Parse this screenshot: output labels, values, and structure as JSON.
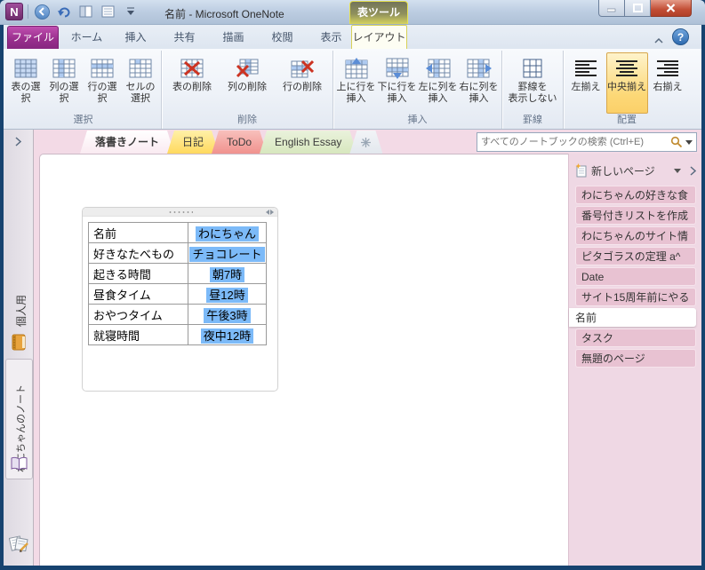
{
  "titlebar": {
    "title": "名前 - Microsoft OneNote",
    "contextual_tool_label": "表ツール"
  },
  "menu_tabs": {
    "file": "ファイル",
    "items": [
      "ホーム",
      "挿入",
      "共有",
      "描画",
      "校閲",
      "表示"
    ],
    "active_contextual": "レイアウト"
  },
  "ribbon": {
    "groups": [
      {
        "label": "選択",
        "buttons": [
          "表の選択",
          "列の選択",
          "行の選択",
          "セルの\n選択"
        ]
      },
      {
        "label": "削除",
        "buttons": [
          "表の削除",
          "列の削除",
          "行の削除"
        ]
      },
      {
        "label": "挿入",
        "buttons": [
          "上に行を\n挿入",
          "下に行を\n挿入",
          "左に列を\n挿入",
          "右に列を\n挿入"
        ]
      },
      {
        "label": "罫線",
        "buttons": [
          "罫線を\n表示しない"
        ]
      },
      {
        "label": "配置",
        "buttons": [
          "左揃え",
          "中央揃え",
          "右揃え"
        ],
        "selected": "中央揃え"
      }
    ]
  },
  "sections": {
    "tabs": [
      {
        "label": "落書きノート",
        "active": true
      },
      {
        "label": "日記"
      },
      {
        "label": "ToDo"
      },
      {
        "label": "English Essay"
      }
    ]
  },
  "search": {
    "placeholder": "すべてのノートブックの検索 (Ctrl+E)"
  },
  "nav": {
    "notebooks": [
      {
        "label": "個人用"
      },
      {
        "label": "わにちゃんのノート",
        "active": true
      }
    ]
  },
  "pages": {
    "new_page_label": "新しいページ",
    "items": [
      {
        "title": "わにちゃんの好きな食"
      },
      {
        "title": "番号付きリストを作成"
      },
      {
        "title": "わにちゃんのサイト情"
      },
      {
        "title": "ピタゴラスの定理 a^"
      },
      {
        "title": "Date"
      },
      {
        "title": "サイト15周年前にやる"
      },
      {
        "title": "名前",
        "active": true
      },
      {
        "title": "タスク"
      },
      {
        "title": "無題のページ"
      }
    ]
  },
  "note_table": {
    "rows": [
      {
        "label": "名前",
        "value": "わにちゃん"
      },
      {
        "label": "好きなたべもの",
        "value": "チョコレート"
      },
      {
        "label": "起きる時間",
        "value": "朝7時"
      },
      {
        "label": "昼食タイム",
        "value": "昼12時"
      },
      {
        "label": "おやつタイム",
        "value": "午後3時"
      },
      {
        "label": "就寝時間",
        "value": "夜中12時"
      }
    ]
  },
  "icons": {
    "logo_letter": "N",
    "help_glyph": "?"
  },
  "colors": {
    "selection_highlight": "#7CBAF8",
    "file_tab_purple": "#9A2F8E",
    "contextual_yellow": "#D6D35F",
    "align_selected_orange": "#FCD877",
    "sidebar_pink": "#EFD8E4",
    "page_tab_pink": "#E8C2D2"
  }
}
